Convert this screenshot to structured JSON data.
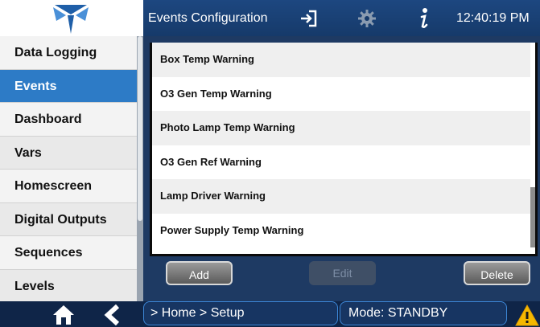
{
  "header": {
    "title": "Events Configuration",
    "time": "12:40:19 PM",
    "icons": [
      "logo",
      "login-icon",
      "gear-icon",
      "info-icon"
    ]
  },
  "sidebar": {
    "items": [
      {
        "label": "Data Logging",
        "active": false
      },
      {
        "label": "Events",
        "active": true
      },
      {
        "label": "Dashboard",
        "active": false
      },
      {
        "label": "Vars",
        "active": false
      },
      {
        "label": "Homescreen",
        "active": false
      },
      {
        "label": "Digital Outputs",
        "active": false
      },
      {
        "label": "Sequences",
        "active": false
      },
      {
        "label": "Levels",
        "active": false
      }
    ]
  },
  "events_list": {
    "items": [
      "Box Temp Warning",
      "O3 Gen Temp Warning",
      "Photo Lamp Temp Warning",
      "O3 Gen Ref Warning",
      "Lamp Driver Warning",
      "Power Supply Temp Warning"
    ]
  },
  "actions": {
    "add_label": "Add",
    "edit_label": "Edit",
    "delete_label": "Delete",
    "edit_enabled": false
  },
  "footer": {
    "breadcrumb": "> Home > Setup",
    "mode": "Mode: STANDBY",
    "icons": [
      "home-icon",
      "back-icon",
      "warning-icon"
    ]
  },
  "colors": {
    "header_bg": "#1d4780",
    "active_item": "#2d7bc6",
    "footer_bg": "#0f2548",
    "warning": "#f5b800"
  }
}
